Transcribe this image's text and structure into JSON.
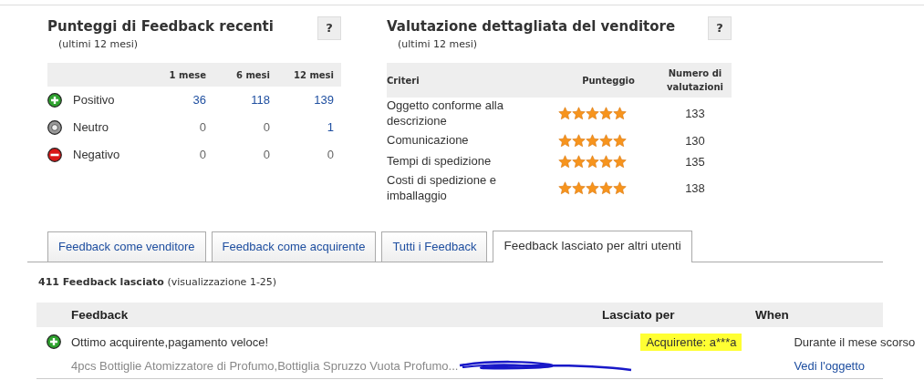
{
  "recent": {
    "title": "Punteggi di Feedback recenti",
    "subtitle": "(ultimi 12 mesi)",
    "help": "?",
    "columns": [
      "1 mese",
      "6 mesi",
      "12 mesi"
    ],
    "rows": [
      {
        "kind": "positive",
        "label": "Positivo",
        "values": [
          {
            "text": "36",
            "link": true
          },
          {
            "text": "118",
            "link": true
          },
          {
            "text": "139",
            "link": true
          }
        ]
      },
      {
        "kind": "neutral",
        "label": "Neutro",
        "values": [
          {
            "text": "0",
            "link": false
          },
          {
            "text": "0",
            "link": false
          },
          {
            "text": "1",
            "link": true
          }
        ]
      },
      {
        "kind": "negative",
        "label": "Negativo",
        "values": [
          {
            "text": "0",
            "link": false
          },
          {
            "text": "0",
            "link": false
          },
          {
            "text": "0",
            "link": false
          }
        ]
      }
    ]
  },
  "detailed": {
    "title": "Valutazione dettagliata del venditore",
    "subtitle": "(ultimi 12 mesi)",
    "help": "?",
    "columns": [
      "Criteri",
      "Punteggio",
      "Numero di valutazioni"
    ],
    "rows": [
      {
        "label": "Oggetto conforme alla descrizione",
        "stars": 5,
        "count": "133"
      },
      {
        "label": "Comunicazione",
        "stars": 5,
        "count": "130"
      },
      {
        "label": "Tempi di spedizione",
        "stars": 5,
        "count": "135"
      },
      {
        "label": "Costi di spedizione e imballaggio",
        "stars": 5,
        "count": "138"
      }
    ]
  },
  "tabs": [
    {
      "label": "Feedback come venditore",
      "selected": false
    },
    {
      "label": "Feedback come acquirente",
      "selected": false
    },
    {
      "label": "Tutti i Feedback",
      "selected": false
    },
    {
      "label": "Feedback lasciato per altri utenti",
      "selected": true
    }
  ],
  "summary": {
    "count": "411 Feedback lasciato",
    "range": "(visualizzazione 1-25)"
  },
  "table": {
    "columns": [
      "Feedback",
      "Lasciato per",
      "When"
    ],
    "rows": [
      {
        "kind": "positive",
        "comment": "Ottimo acquirente,pagamento veloce!",
        "item": "4pcs Bottiglie Atomizzatore di Profumo,Bottiglia Spruzzo Vuota Profumo...",
        "left_for": "Acquirente: a***a",
        "highlighted": true,
        "when": "Durante il mese scorso",
        "link": "Vedi l'oggetto"
      }
    ]
  }
}
